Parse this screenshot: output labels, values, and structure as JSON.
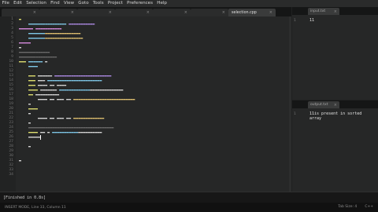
{
  "menu": [
    "File",
    "Edit",
    "Selection",
    "Find",
    "View",
    "Goto",
    "Tools",
    "Project",
    "Preferences",
    "Help"
  ],
  "tabs": [
    {
      "label": "",
      "active": false
    },
    {
      "label": "",
      "active": false
    },
    {
      "label": "",
      "active": false
    },
    {
      "label": "",
      "active": false
    },
    {
      "label": "",
      "active": false
    },
    {
      "label": "",
      "active": false
    },
    {
      "label": "selection.cpp",
      "active": true
    }
  ],
  "editor": {
    "line_numbers": [
      "1",
      "2",
      "3",
      "4",
      "5",
      "6",
      "7",
      "8",
      "9",
      "10",
      "11",
      "12",
      "13",
      "14",
      "15",
      "16",
      "17",
      "18",
      "19",
      "20",
      "21",
      "22",
      "23",
      "24",
      "25",
      "26",
      "27",
      "28",
      "29",
      "30",
      "31",
      "32",
      "33",
      "34"
    ]
  },
  "input_pane": {
    "tab_label": "input.txt",
    "lines": [
      "11"
    ]
  },
  "output_pane": {
    "tab_label": "output.txt",
    "lines": [
      "11is present in sorted",
      "array"
    ]
  },
  "console": {
    "text": "[Finished in 0.8s]"
  },
  "statusbar": {
    "left": "INSERT MODE, Line 33, Column 11",
    "tab_size": "Tab Size: 4",
    "syntax": "C++"
  }
}
